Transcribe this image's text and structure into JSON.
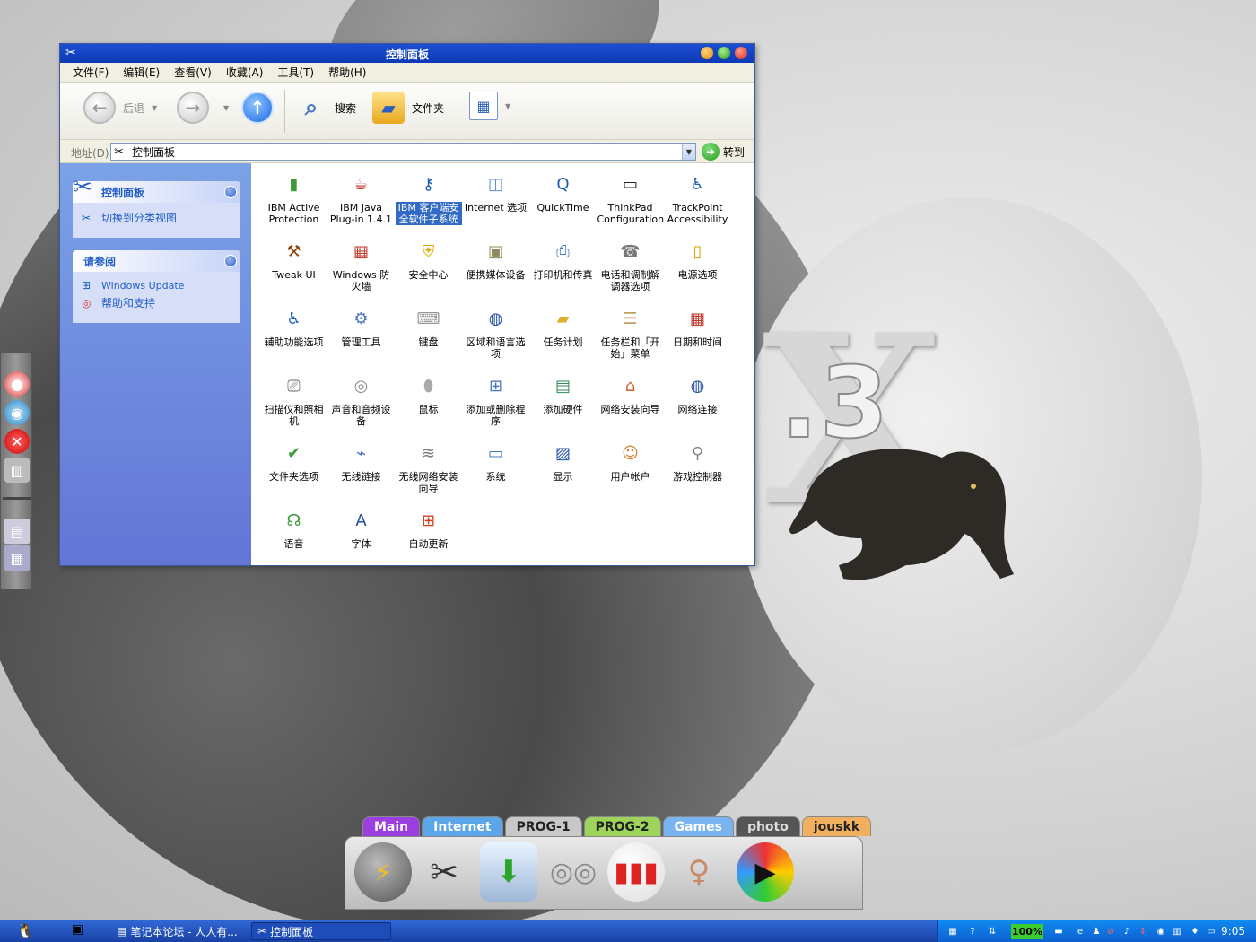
{
  "window": {
    "title": "控制面板",
    "menu": [
      "文件(F)",
      "编辑(E)",
      "查看(V)",
      "收藏(A)",
      "工具(T)",
      "帮助(H)"
    ],
    "toolbar": {
      "back_label": "后退",
      "search_label": "搜索",
      "folders_label": "文件夹"
    },
    "address": {
      "label": "地址(D)",
      "value": "控制面板",
      "go_label": "转到"
    },
    "taskpane": {
      "panel_title": "控制面板",
      "switch_view": "切换到分类视图",
      "see_also_title": "请参阅",
      "windows_update": "Windows Update",
      "help_support": "帮助和支持"
    },
    "items": [
      {
        "label": "IBM Active Protection",
        "icon": "hdd-shield-icon",
        "color": "#3a9a3a"
      },
      {
        "label": "IBM Java Plug-in 1.4.1",
        "icon": "java-cup-icon",
        "color": "#c0392b"
      },
      {
        "label": "IBM 客户端安全软件子系统",
        "icon": "key-icon",
        "color": "#1c5fb8",
        "selected": true
      },
      {
        "label": "Internet 选项",
        "icon": "globe-monitor-icon",
        "color": "#5b8fd6"
      },
      {
        "label": "QuickTime",
        "icon": "quicktime-icon",
        "color": "#1f5db4"
      },
      {
        "label": "ThinkPad Configuration",
        "icon": "laptop-icon",
        "color": "#222222"
      },
      {
        "label": "TrackPoint Accessibility",
        "icon": "accessibility-icon",
        "color": "#1c5fb8"
      },
      {
        "label": "Tweak UI",
        "icon": "tweak-icon",
        "color": "#8b4513"
      },
      {
        "label": "Windows 防火墙",
        "icon": "firewall-icon",
        "color": "#c0392b"
      },
      {
        "label": "安全中心",
        "icon": "shield-icon",
        "color": "#e0a800"
      },
      {
        "label": "便携媒体设备",
        "icon": "media-device-icon",
        "color": "#8a8a5a"
      },
      {
        "label": "打印机和传真",
        "icon": "printer-icon",
        "color": "#4a78c0"
      },
      {
        "label": "电话和调制解调器选项",
        "icon": "phone-icon",
        "color": "#777777"
      },
      {
        "label": "电源选项",
        "icon": "battery-icon",
        "color": "#d4a000"
      },
      {
        "label": "辅助功能选项",
        "icon": "wheelchair-icon",
        "color": "#1c5fb8"
      },
      {
        "label": "管理工具",
        "icon": "admin-tools-icon",
        "color": "#4a78c0"
      },
      {
        "label": "键盘",
        "icon": "keyboard-icon",
        "color": "#999999"
      },
      {
        "label": "区域和语言选项",
        "icon": "globe-icon",
        "color": "#1f4fa0"
      },
      {
        "label": "任务计划",
        "icon": "scheduled-folder-icon",
        "color": "#e0b030"
      },
      {
        "label": "任务栏和「开始」菜单",
        "icon": "taskbar-icon",
        "color": "#c0a060"
      },
      {
        "label": "日期和时间",
        "icon": "calendar-icon",
        "color": "#c0392b"
      },
      {
        "label": "扫描仪和照相机",
        "icon": "scanner-icon",
        "color": "#666666"
      },
      {
        "label": "声音和音频设备",
        "icon": "speaker-icon",
        "color": "#888888"
      },
      {
        "label": "鼠标",
        "icon": "mouse-icon",
        "color": "#aaaaaa"
      },
      {
        "label": "添加或删除程序",
        "icon": "add-remove-icon",
        "color": "#4a78c0"
      },
      {
        "label": "添加硬件",
        "icon": "hardware-icon",
        "color": "#2e8b57"
      },
      {
        "label": "网络安装向导",
        "icon": "network-home-icon",
        "color": "#d06030"
      },
      {
        "label": "网络连接",
        "icon": "network-globe-icon",
        "color": "#1f4fa0"
      },
      {
        "label": "文件夹选项",
        "icon": "folder-check-icon",
        "color": "#3a9a3a"
      },
      {
        "label": "无线链接",
        "icon": "wireless-link-icon",
        "color": "#4a78c0"
      },
      {
        "label": "无线网络安装向导",
        "icon": "wireless-icon",
        "color": "#777777"
      },
      {
        "label": "系统",
        "icon": "system-monitor-icon",
        "color": "#4a78c0"
      },
      {
        "label": "显示",
        "icon": "display-icon",
        "color": "#1f4fa0"
      },
      {
        "label": "用户帐户",
        "icon": "user-icon",
        "color": "#d08030"
      },
      {
        "label": "游戏控制器",
        "icon": "joystick-icon",
        "color": "#888888"
      },
      {
        "label": "语音",
        "icon": "speech-icon",
        "color": "#3a9a3a"
      },
      {
        "label": "字体",
        "icon": "font-icon",
        "color": "#1f4fa0"
      },
      {
        "label": "自动更新",
        "icon": "windows-update-icon",
        "color": "#d04020"
      }
    ]
  },
  "dock": {
    "tabs": [
      {
        "label": "Main",
        "color": "#9b3fe0",
        "text": "#ffffff"
      },
      {
        "label": "Internet",
        "color": "#5aa6e8",
        "text": "#ffffff"
      },
      {
        "label": "PROG-1",
        "color": "#c8c8c8",
        "text": "#222222"
      },
      {
        "label": "PROG-2",
        "color": "#9fd45a",
        "text": "#222222"
      },
      {
        "label": "Games",
        "color": "#7ab4f0",
        "text": "#ffffff"
      },
      {
        "label": "photo",
        "color": "#555555",
        "text": "#dddddd"
      },
      {
        "label": "jouskk",
        "color": "#f0b060",
        "text": "#222222"
      }
    ]
  },
  "taskbar": {
    "tasks": [
      "笔记本论坛 - 人人有...",
      "控制面板"
    ],
    "battery_percent": "100%",
    "clock": "9:05"
  }
}
